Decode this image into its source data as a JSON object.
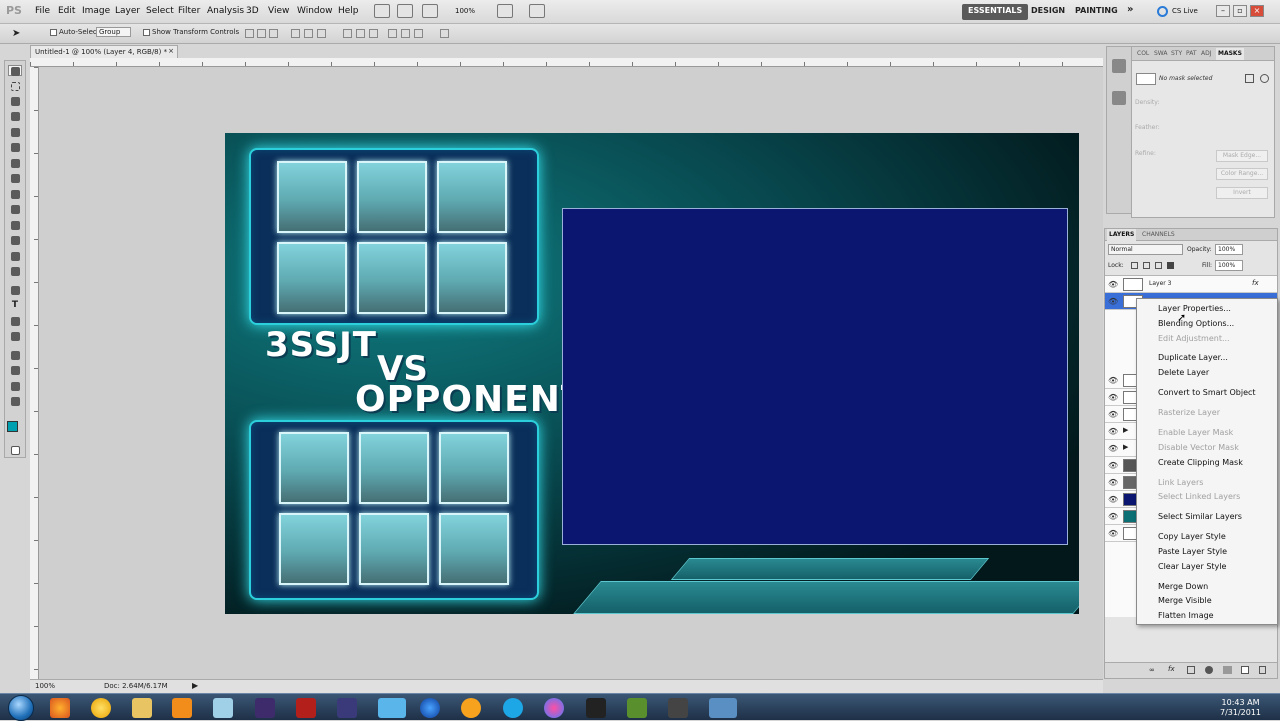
{
  "app": {
    "logo": "PS",
    "menus": [
      "File",
      "Edit",
      "Image",
      "Layer",
      "Select",
      "Filter",
      "Analysis",
      "3D",
      "View",
      "Window",
      "Help"
    ],
    "zoom_menu": "100%",
    "workspaces": [
      "ESSENTIALS",
      "DESIGN",
      "PAINTING"
    ],
    "more_glyph": "»",
    "cs_live": "CS Live"
  },
  "options": {
    "auto_select_label": "Auto-Select:",
    "auto_select_value": "Group",
    "show_transform_label": "Show Transform Controls"
  },
  "document": {
    "tab_title": "Untitled-1 @ 100% (Layer 4, RGB/8) *",
    "zoom": "100%",
    "doc_info": "Doc: 2.64M/6.17M"
  },
  "artwork": {
    "title_line1": "3SSJT",
    "vs": "VS",
    "title_line2": "OPPONENT"
  },
  "masks_panel": {
    "tabs": [
      "COL",
      "SWA",
      "STY",
      "PAT",
      "ADJ",
      "MASKS"
    ],
    "no_mask": "No mask selected",
    "density": "Density:",
    "feather": "Feather:",
    "refine": "Refine:",
    "btn_mask_edge": "Mask Edge...",
    "btn_color_range": "Color Range...",
    "btn_invert": "Invert"
  },
  "layers_panel": {
    "tabs": [
      "LAYERS",
      "CHANNELS"
    ],
    "blend_mode": "Normal",
    "opacity_label": "Opacity:",
    "opacity_value": "100%",
    "lock_label": "Lock:",
    "fill_label": "Fill:",
    "fill_value": "100%",
    "top_layer": "Layer 3",
    "fx": "fx"
  },
  "context_menu": {
    "items": [
      {
        "label": "Layer Properties...",
        "enabled": true
      },
      {
        "label": "Blending Options...",
        "enabled": true
      },
      {
        "label": "Edit Adjustment...",
        "enabled": false
      },
      {
        "label": "Duplicate Layer...",
        "enabled": true
      },
      {
        "label": "Delete Layer",
        "enabled": true
      },
      {
        "label": "Convert to Smart Object",
        "enabled": true
      },
      {
        "label": "Rasterize Layer",
        "enabled": false
      },
      {
        "label": "Enable Layer Mask",
        "enabled": false
      },
      {
        "label": "Disable Vector Mask",
        "enabled": false
      },
      {
        "label": "Create Clipping Mask",
        "enabled": true
      },
      {
        "label": "Link Layers",
        "enabled": false
      },
      {
        "label": "Select Linked Layers",
        "enabled": false
      },
      {
        "label": "Select Similar Layers",
        "enabled": true
      },
      {
        "label": "Copy Layer Style",
        "enabled": true
      },
      {
        "label": "Paste Layer Style",
        "enabled": true
      },
      {
        "label": "Clear Layer Style",
        "enabled": true
      },
      {
        "label": "Merge Down",
        "enabled": true
      },
      {
        "label": "Merge Visible",
        "enabled": true
      },
      {
        "label": "Flatten Image",
        "enabled": true
      }
    ]
  },
  "taskbar": {
    "time": "10:43 AM",
    "date": "7/31/2011"
  },
  "colors": {
    "accent_cyan": "#2bd0dc",
    "video_box": "#0a1670",
    "foreground_swatch": "#00a0b0",
    "background_swatch": "#000000"
  }
}
